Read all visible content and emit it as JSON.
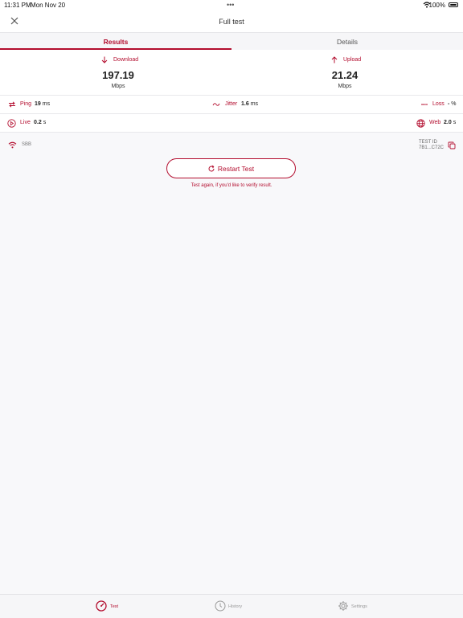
{
  "status_bar": {
    "time": "11:31 PM",
    "date": "Mon Nov 20",
    "battery": "100%"
  },
  "header": {
    "title": "Full test"
  },
  "tabs": [
    {
      "label": "Results"
    },
    {
      "label": "Details"
    }
  ],
  "results": {
    "download": {
      "label": "Download",
      "value": "197.19",
      "unit": "Mbps"
    },
    "upload": {
      "label": "Upload",
      "value": "21.24",
      "unit": "Mbps"
    },
    "ping": {
      "label": "Ping",
      "value": "19",
      "unit": "ms"
    },
    "jitter": {
      "label": "Jitter",
      "value": "1.6",
      "unit": "ms"
    },
    "loss": {
      "label": "Loss",
      "value": "-",
      "unit": "%"
    },
    "live": {
      "label": "Live",
      "value": "0.2",
      "unit": "s"
    },
    "web": {
      "label": "Web",
      "value": "2.0",
      "unit": "s"
    }
  },
  "network": {
    "name": "SBB",
    "test_id_label": "TEST ID",
    "test_id_value": "7B1...C72C"
  },
  "restart": {
    "label": "Restart Test",
    "hint": "Test again, if you'd like to verify result."
  },
  "bottom_nav": [
    {
      "label": "Test"
    },
    {
      "label": "History"
    },
    {
      "label": "Settings"
    }
  ],
  "colors": {
    "accent": "#b30d2e",
    "background": "#f8f8fa"
  }
}
